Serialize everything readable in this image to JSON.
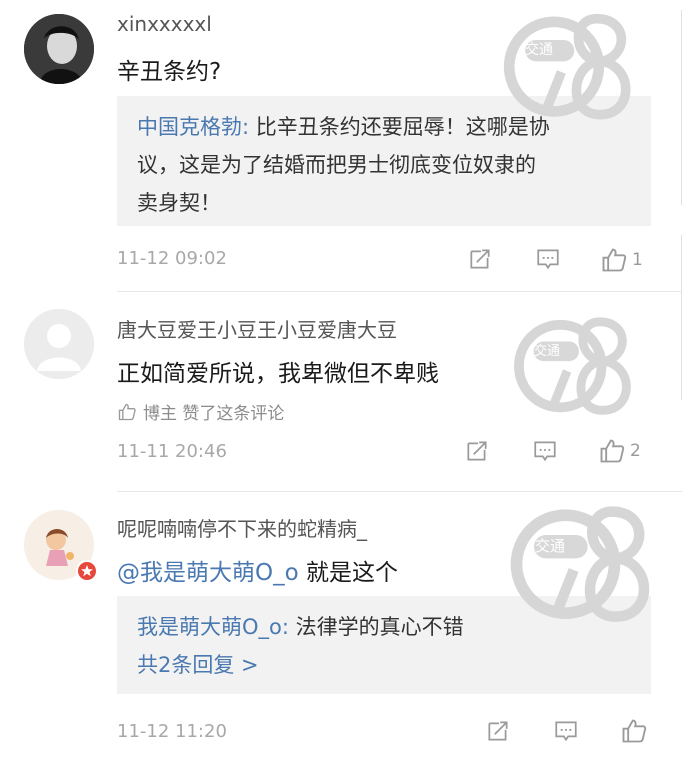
{
  "comments": [
    {
      "username": "xinxxxxxl",
      "text": "辛丑条约?",
      "reply_author": "中国克格勃:",
      "reply_text_1": " 比辛丑条约还要屈辱！这哪是协",
      "reply_text_2": "议，这是为了结婚而把男士彻底变位奴隶的",
      "reply_text_3": "卖身契！",
      "time": "11-12 09:02",
      "like_count": "1"
    },
    {
      "username": "唐大豆爱王小豆王小豆爱唐大豆",
      "text": "正如简爱所说，我卑微但不卑贱",
      "liked_by": "博主 赞了这条评论",
      "time": "11-11 20:46",
      "like_count": "2"
    },
    {
      "username": "呢呢喃喃停不下来的蛇精病_",
      "mention": "@我是萌大萌O_o",
      "text": " 就是这个",
      "reply_author": "我是萌大萌O_o:",
      "reply_text_1": " 法律学的真心不错",
      "more_replies": "共2条回复 >",
      "time": "11-12 11:20",
      "like_count": ""
    }
  ],
  "watermark": {
    "badge": "交通",
    "number": "98"
  },
  "icons": [
    "forward-icon",
    "comment-icon",
    "thumbs-up-icon",
    "avatar-badge-icon",
    "watermark-logo"
  ],
  "colors": {
    "link": "#4a78b0",
    "meta": "#a8a8a8",
    "quote_bg": "#f2f2f2",
    "badge": "#e8473c"
  }
}
